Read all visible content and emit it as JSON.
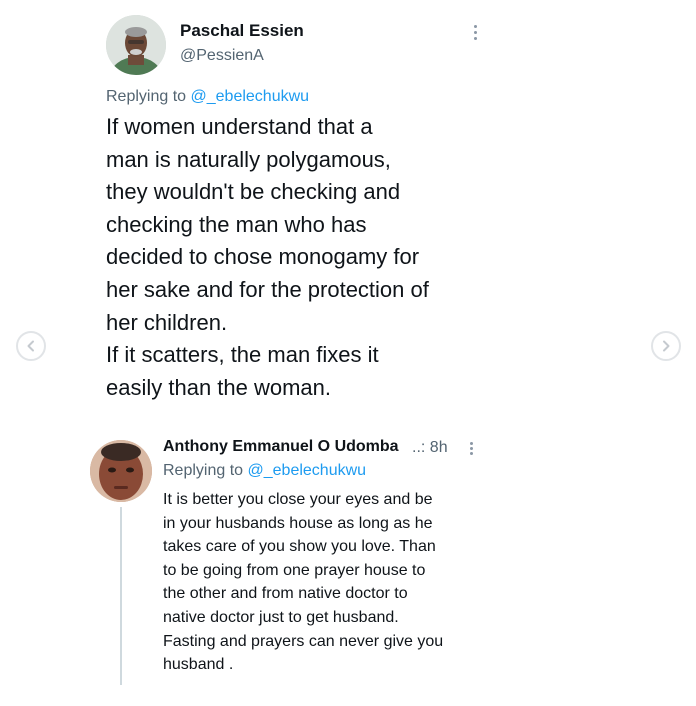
{
  "tweet1": {
    "author_name": "Paschal Essien",
    "author_handle": "@PessienA",
    "replying_prefix": "Replying to ",
    "replying_to": "@_ebelechukwu",
    "text": "If women understand that a\nman is naturally polygamous,\nthey wouldn't be checking and\nchecking the man who has\ndecided to chose monogamy for\nher sake and for the protection of\nher children.\nIf it scatters, the man fixes it\neasily than the woman."
  },
  "tweet2": {
    "author_name": "Anthony Emmanuel O Udomba",
    "time_separator": "..:",
    "time": "8h",
    "replying_prefix": "Replying to ",
    "replying_to": "@_ebelechukwu",
    "text": "It is better  you close your eyes and be\nin your husbands house as long as he\ntakes care of you show you love. Than\nto be going from one prayer house to\nthe other and from native doctor to\nnative doctor just to get husband.\nFasting and prayers can never give you\nhusband ."
  },
  "navigation": {
    "prev_icon": "chevron-left-icon",
    "next_icon": "chevron-right-icon"
  },
  "colors": {
    "link": "#1d9bf0",
    "secondary_text": "#536471",
    "primary_text": "#0f1419"
  }
}
